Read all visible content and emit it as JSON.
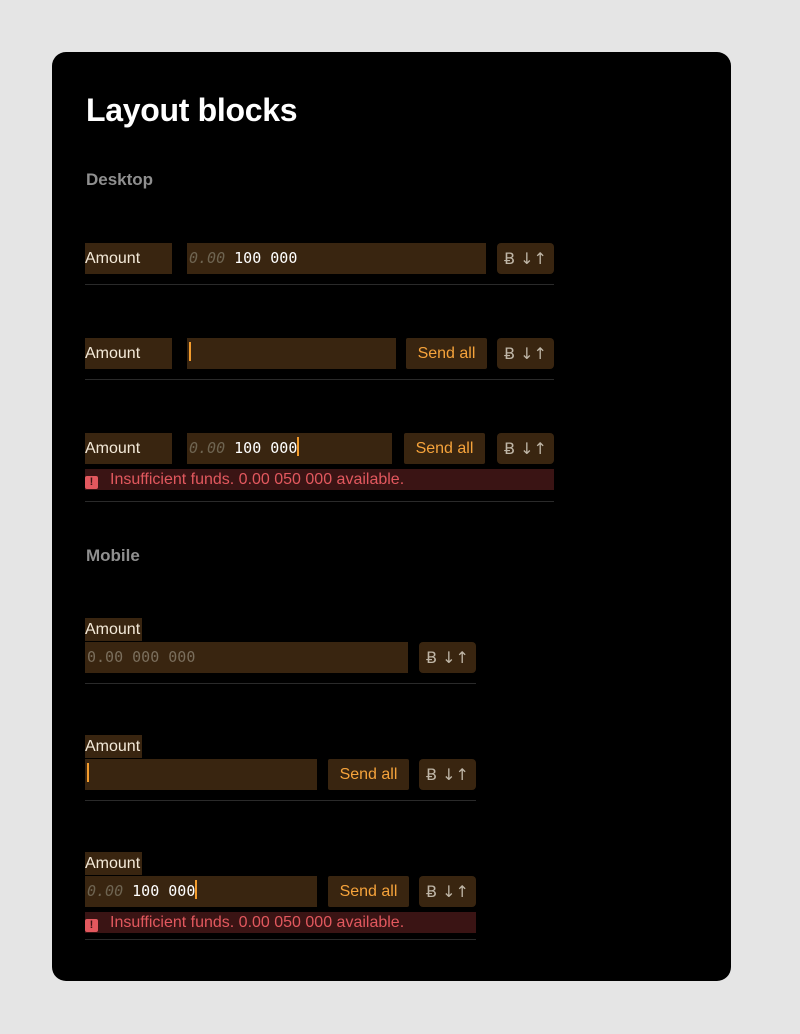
{
  "title": "Layout blocks",
  "sections": {
    "desktop": "Desktop",
    "mobile": "Mobile"
  },
  "labels": {
    "amount": "Amount",
    "send_all": "Send all",
    "unit": "Ƀ ↓↑"
  },
  "icons": {
    "error": "!"
  },
  "values": {
    "placeholder_prefix": "0.00",
    "entered": "100 000",
    "full_placeholder": "0.00 000 000"
  },
  "error_message": "Insufficient funds. 0.00 050 000 available.",
  "colors": {
    "card": "#000000",
    "field_bg": "#392510",
    "accent": "#f6a33b",
    "error": "#e2585e",
    "error_bg": "#3a1414"
  }
}
